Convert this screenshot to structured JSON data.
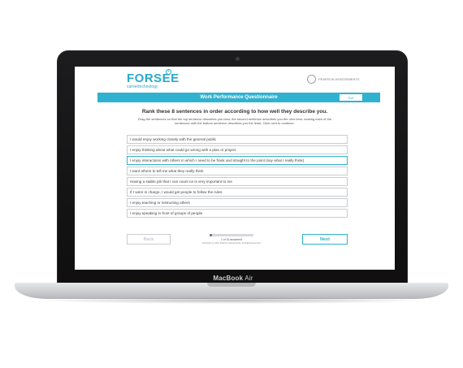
{
  "brand": {
    "logo": "FORSEE",
    "logo_sub": "careertechnology",
    "logo_mark": "+",
    "partner": "PEARSON ASSESSMENTS"
  },
  "header": {
    "title": "Work Performance Questionnaire",
    "exit_label": "Exit"
  },
  "question": {
    "heading": "Rank these 8 sentences in order according to how well they describe you.",
    "instructions": "Drag the sentences so that the top sentence describes you best, the second sentence describes you the next best, ranking each of the sentences until the bottom sentence describes you the least. Click next to continue."
  },
  "sentences": [
    "I would enjoy working closely with the general public",
    "I enjoy thinking about what could go wrong with a plan or project",
    "I enjoy interactions with others in which I need to be frank and straight to the point (say what I really think)",
    "I want others to tell me what they really think",
    "Having a stable job that I can count on is very important to me",
    "If I were in charge, I would get people to follow the rules",
    "I enjoy teaching or instructing others",
    "I enjoy speaking in front of groups of people"
  ],
  "navigation": {
    "back_label": "Back",
    "next_label": "Next",
    "progress_text": "1 of 16 answered",
    "progress_fraction": 0.0625,
    "copyright": "Copyright (c) 2012 Pearson Assessments. All Rights Reserved."
  },
  "device": {
    "brand": "MacBook",
    "model": "Air"
  },
  "colors": {
    "accent": "#2fb2cf",
    "frame": "#111112"
  }
}
